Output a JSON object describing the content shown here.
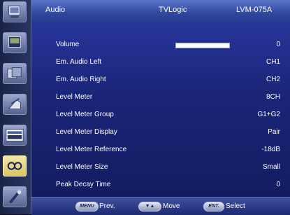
{
  "title_bar": {
    "page": "Audio",
    "brand": "TVLogic",
    "model": "LVM-075A"
  },
  "sidebar": {
    "icons": [
      {
        "name": "monitor-icon",
        "selected": false
      },
      {
        "name": "picture-icon",
        "selected": false
      },
      {
        "name": "color-icon",
        "selected": false
      },
      {
        "name": "input-icon",
        "selected": false
      },
      {
        "name": "display-icon",
        "selected": false
      },
      {
        "name": "audio-icon",
        "selected": true
      },
      {
        "name": "tools-icon",
        "selected": false
      }
    ]
  },
  "menu": {
    "volume": {
      "label": "Volume",
      "value": "0",
      "level": 1.0
    },
    "items": [
      {
        "label": "Em. Audio Left",
        "value": "CH1"
      },
      {
        "label": "Em. Audio Right",
        "value": "CH2"
      },
      {
        "label": "Level Meter",
        "value": "8CH"
      },
      {
        "label": "Level Meter Group",
        "value": "G1+G2"
      },
      {
        "label": "Level Meter Display",
        "value": "Pair"
      },
      {
        "label": "Level Meter Reference",
        "value": "-18dB"
      },
      {
        "label": "Level Meter Size",
        "value": "Small"
      },
      {
        "label": "Peak Decay Time",
        "value": "0"
      }
    ]
  },
  "footer": {
    "menu_key": "MENU",
    "prev_label": "Prev.",
    "move_key": "▼▲",
    "move_label": "Move",
    "enter_key": "ENT.",
    "select_label": "Select"
  },
  "colors": {
    "selected_icon": "#e8d880",
    "title_bar": "#3a52b0",
    "menu_bg": "#1a2578"
  }
}
